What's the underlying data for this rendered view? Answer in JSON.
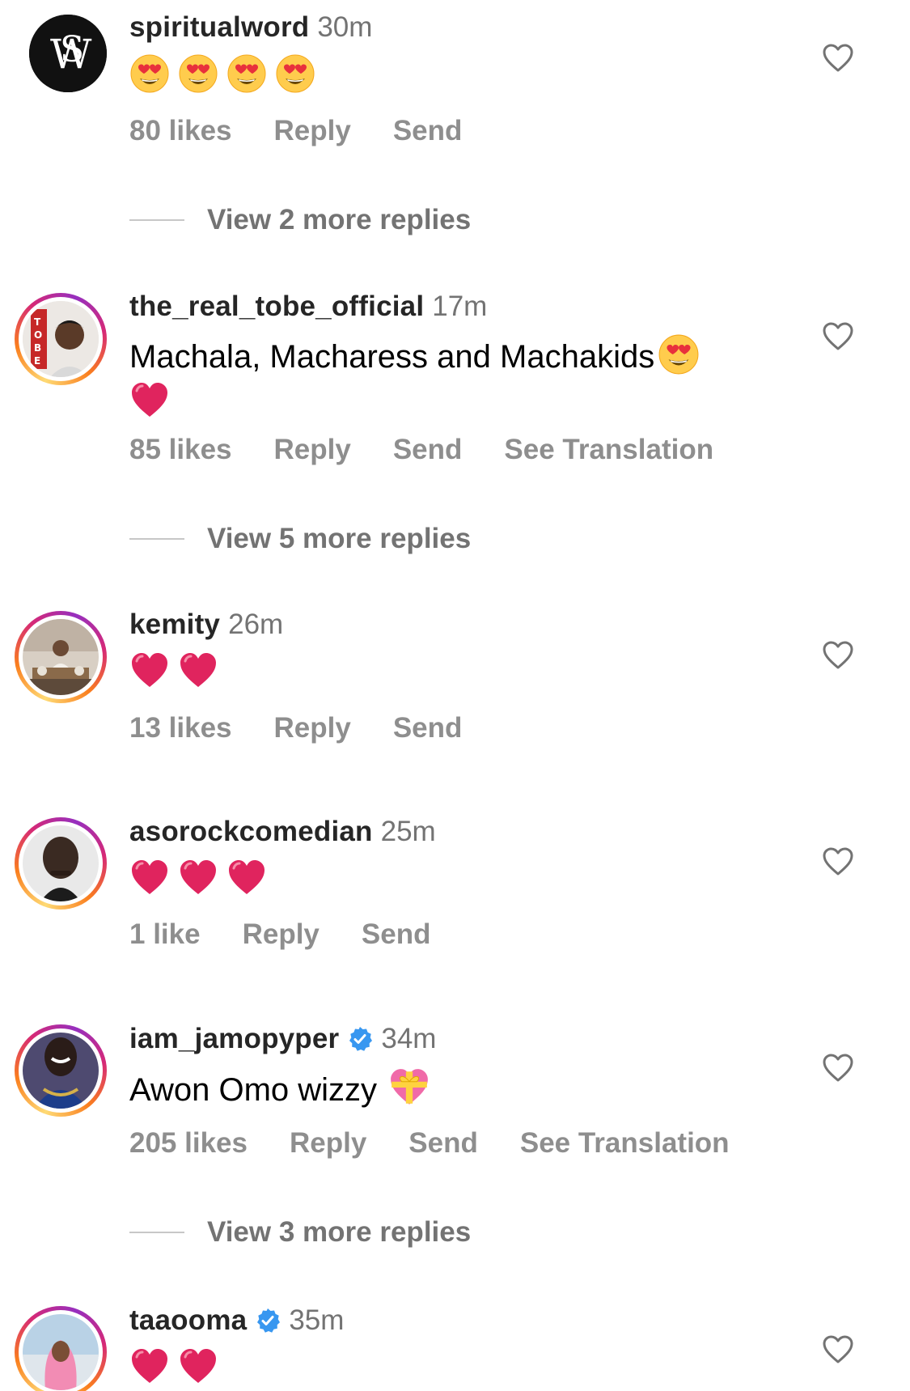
{
  "comments": [
    {
      "username": "spiritualword",
      "time": "30m",
      "verified": false,
      "likes": "80 likes",
      "reply": "Reply",
      "send": "Send",
      "view_replies": "View 2 more replies"
    },
    {
      "username": "the_real_tobe_official",
      "time": "17m",
      "verified": false,
      "text": "Machala, Macharess and Machakids",
      "likes": "85 likes",
      "reply": "Reply",
      "send": "Send",
      "see_translation": "See Translation",
      "view_replies": "View 5 more replies"
    },
    {
      "username": "kemity",
      "time": "26m",
      "verified": false,
      "likes": "13 likes",
      "reply": "Reply",
      "send": "Send"
    },
    {
      "username": "asorockcomedian",
      "time": "25m",
      "verified": false,
      "likes": "1 like",
      "reply": "Reply",
      "send": "Send"
    },
    {
      "username": "iam_jamopyper",
      "time": "34m",
      "verified": true,
      "text": "Awon Omo wizzy",
      "likes": "205 likes",
      "reply": "Reply",
      "send": "Send",
      "see_translation": "See Translation",
      "view_replies": "View 3 more replies"
    },
    {
      "username": "taaooma",
      "time": "35m",
      "verified": true
    }
  ],
  "icons": {
    "like": "heart-outline-icon",
    "verified": "verified-badge-icon",
    "heart_emoji": "red-heart-emoji",
    "heart_eyes_emoji": "heart-eyes-emoji",
    "gift_heart_emoji": "heart-with-ribbon-emoji"
  },
  "colors": {
    "text_primary": "#262626",
    "text_secondary": "#8e8e8e",
    "verified_blue": "#3897f0",
    "heart_red": "#e0245e"
  }
}
